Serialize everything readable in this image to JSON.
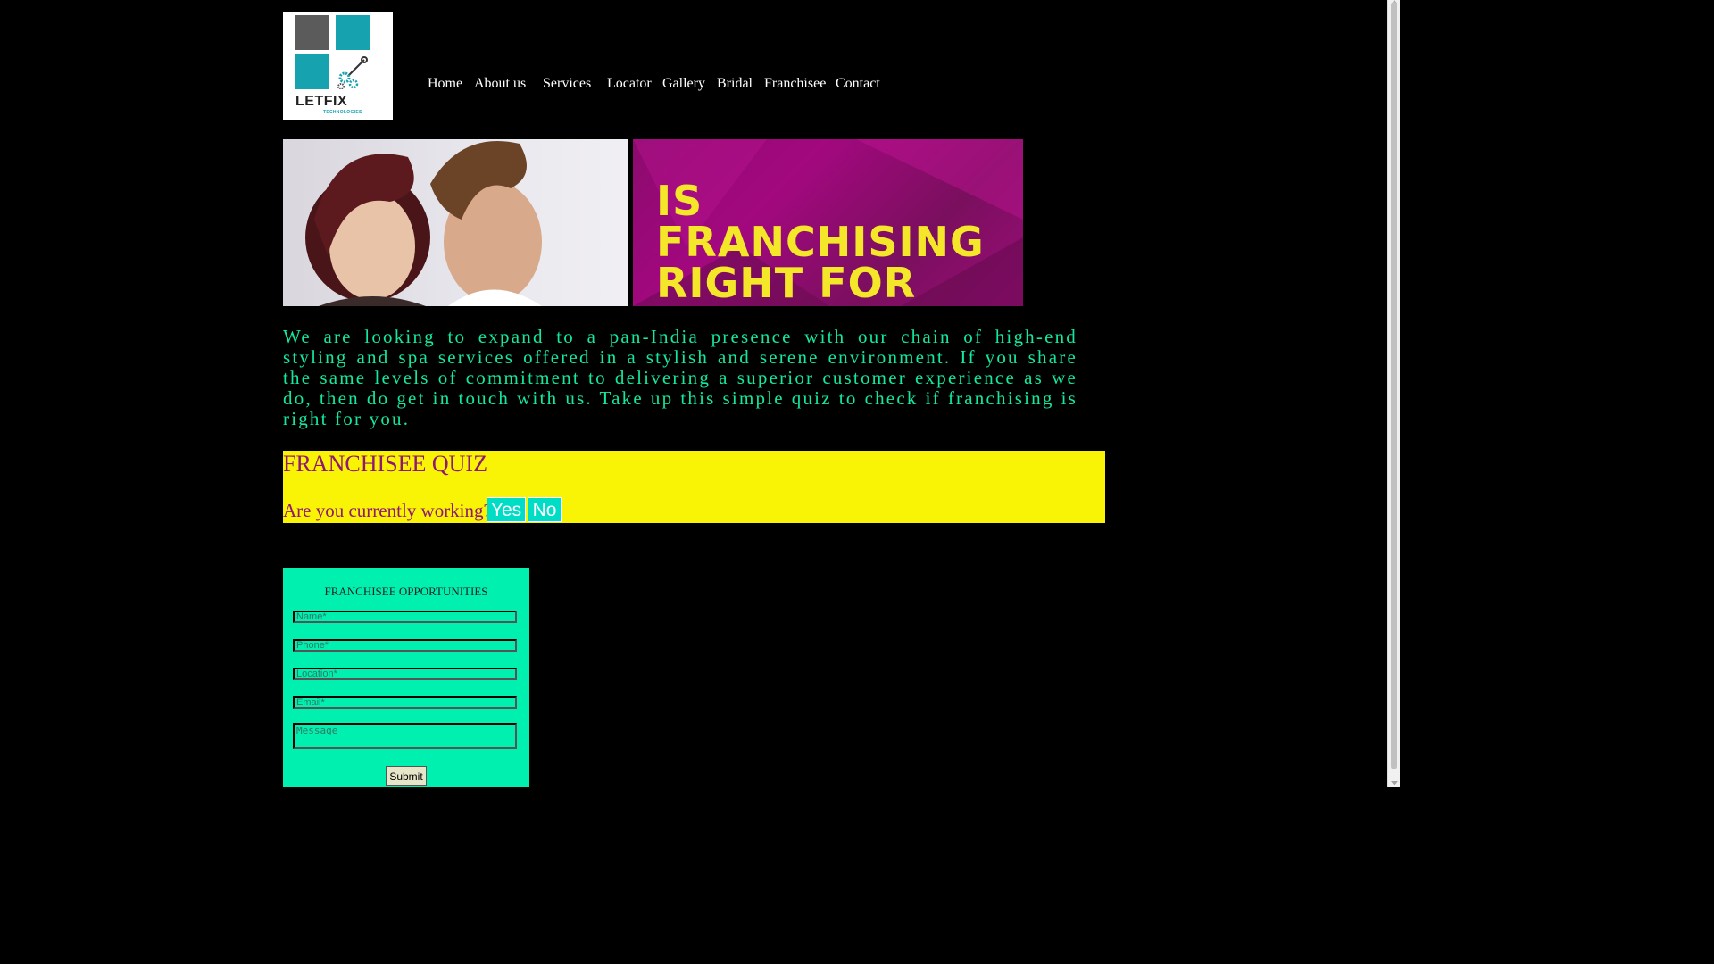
{
  "logo": {
    "brand": "LETFIX",
    "sub": "TECHNOLOGIES",
    "colors": {
      "dark": "#5b5b5b",
      "teal": "#17a2b0"
    }
  },
  "nav": {
    "items": [
      "Home",
      "About us",
      "Services",
      "Locator",
      "Gallery",
      "Bridal",
      "Franchisee",
      "Contact"
    ]
  },
  "hero": {
    "headline_line1": "IS FRANCHISING",
    "headline_line2": "RIGHT FOR YOU?"
  },
  "intro": "We are looking to expand to a pan-India presence with our chain of high-end styling and spa services offered in a stylish and serene environment. If you share the same levels of commitment to delivering a superior customer experience as we do, then do get in touch with us. Take up this simple quiz to check if franchising is right for you.",
  "quiz": {
    "title": "FRANCHISEE QUIZ",
    "question": "Are you currently working?",
    "yes": "Yes",
    "no": "No"
  },
  "form": {
    "title": "FRANCHISEE OPPORTUNITIES",
    "name_placeholder": "Name*",
    "phone_placeholder": "Phone*",
    "location_placeholder": "Location*",
    "email_placeholder": "Email*",
    "message_placeholder": "Message",
    "submit": "Submit"
  },
  "colors": {
    "background": "#000000",
    "accent_green": "#13e89b",
    "quiz_yellow": "#f9f306",
    "quiz_text": "#8e1872",
    "form_bg": "#00f0b0",
    "button_teal": "#00ddc6",
    "hero_magenta": "#a3087f",
    "headline_yellow": "#f4e628"
  }
}
